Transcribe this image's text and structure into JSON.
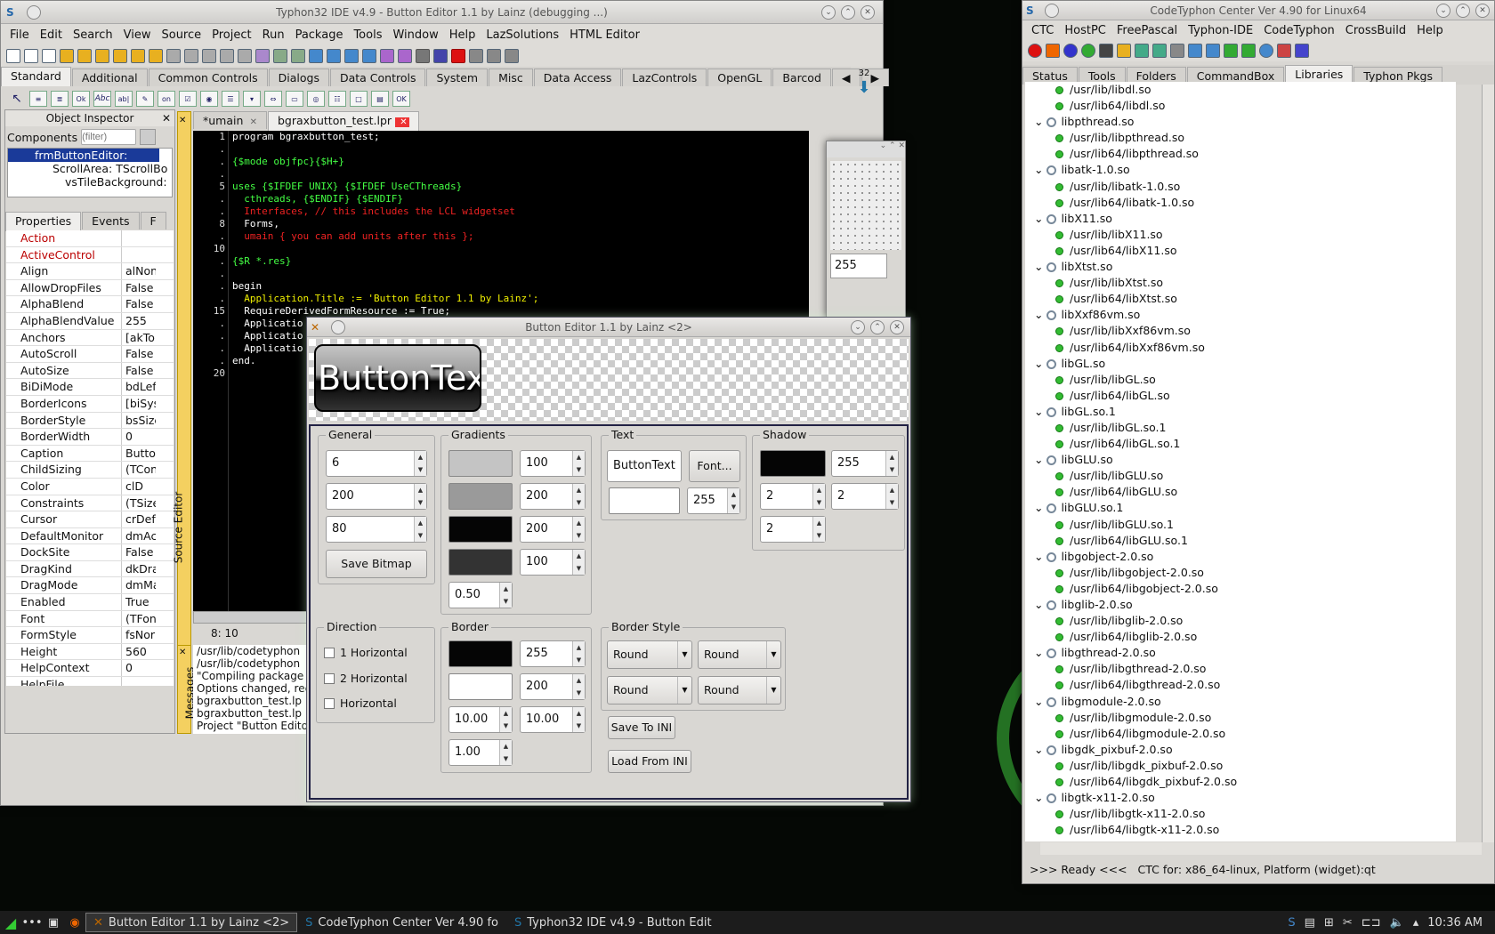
{
  "ide": {
    "title": "Typhon32 IDE v4.9 - Button Editor 1.1 by Lainz (debugging ...)",
    "menu": [
      "File",
      "Edit",
      "Search",
      "View",
      "Source",
      "Project",
      "Run",
      "Package",
      "Tools",
      "Window",
      "Help",
      "LazSolutions",
      "HTML Editor"
    ],
    "palette_tabs": [
      "Standard",
      "Additional",
      "Common Controls",
      "Dialogs",
      "Data Controls",
      "System",
      "Misc",
      "Data Access",
      "LazControls",
      "OpenGL",
      "Barcod"
    ],
    "palette_counter": "32",
    "object_inspector": {
      "title": "Object Inspector",
      "components_label": "Components",
      "filter_placeholder": "(filter)",
      "tree": [
        "frmButtonEditor: TfrmB",
        "ScrollArea: TScrollBo",
        "vsTileBackground:"
      ],
      "tabs": [
        "Properties",
        "Events",
        "F"
      ],
      "properties": [
        {
          "name": "Action",
          "value": "",
          "red": true
        },
        {
          "name": "ActiveControl",
          "value": "",
          "red": true
        },
        {
          "name": "Align",
          "value": "alNon"
        },
        {
          "name": "AllowDropFiles",
          "value": "False"
        },
        {
          "name": "AlphaBlend",
          "value": "False"
        },
        {
          "name": "AlphaBlendValue",
          "value": "255"
        },
        {
          "name": "Anchors",
          "value": "[akTo"
        },
        {
          "name": "AutoScroll",
          "value": "False"
        },
        {
          "name": "AutoSize",
          "value": "False"
        },
        {
          "name": "BiDiMode",
          "value": "bdLef"
        },
        {
          "name": "BorderIcons",
          "value": "[biSys"
        },
        {
          "name": "BorderStyle",
          "value": "bsSize"
        },
        {
          "name": "BorderWidth",
          "value": "0"
        },
        {
          "name": "Caption",
          "value": "Butto"
        },
        {
          "name": "ChildSizing",
          "value": "(TCon"
        },
        {
          "name": "Color",
          "value": "clD"
        },
        {
          "name": "Constraints",
          "value": "(TSize"
        },
        {
          "name": "Cursor",
          "value": "crDefa"
        },
        {
          "name": "DefaultMonitor",
          "value": "dmAc"
        },
        {
          "name": "DockSite",
          "value": "False"
        },
        {
          "name": "DragKind",
          "value": "dkDra"
        },
        {
          "name": "DragMode",
          "value": "dmMa"
        },
        {
          "name": "Enabled",
          "value": "True"
        },
        {
          "name": "Font",
          "value": "(TFon"
        },
        {
          "name": "FormStyle",
          "value": "fsNor"
        },
        {
          "name": "Height",
          "value": "560"
        },
        {
          "name": "HelpContext",
          "value": "0"
        },
        {
          "name": "HelpFile",
          "value": ""
        }
      ]
    },
    "editor_tabs": [
      "*umain",
      "bgraxbutton_test.lpr"
    ],
    "source_editor_label": "Source Editor",
    "messages_label": "Messages",
    "cursor_pos": "8: 10",
    "messages": [
      "/usr/lib/codetyphon",
      "/usr/lib/codetyphon",
      "\"Compiling package p",
      "Options changed, rec",
      "bgraxbutton_test.lp",
      "bgraxbutton_test.lp",
      "Project \"Button Edito"
    ],
    "code": [
      {
        "n": "1",
        "t": "program bgraxbutton_test;",
        "c": "kw"
      },
      {
        "n": ".",
        "t": "",
        "c": "kw"
      },
      {
        "n": ".",
        "t": "{$mode objfpc}{$H+}",
        "c": "dir"
      },
      {
        "n": ".",
        "t": "",
        "c": "kw"
      },
      {
        "n": "5",
        "t": "uses {$IFDEF UNIX} {$IFDEF UseCThreads}",
        "c": "dir"
      },
      {
        "n": ".",
        "t": "  cthreads, {$ENDIF} {$ENDIF}",
        "c": "dir"
      },
      {
        "n": ".",
        "t": "  Interfaces, // this includes the LCL widgetset",
        "c": "cm"
      },
      {
        "n": "8",
        "t": "  Forms,",
        "c": "kw"
      },
      {
        "n": ".",
        "t": "  umain { you can add units after this };",
        "c": "cm"
      },
      {
        "n": "10",
        "t": "",
        "c": "kw"
      },
      {
        "n": ".",
        "t": "{$R *.res}",
        "c": "dir"
      },
      {
        "n": ".",
        "t": "",
        "c": "kw"
      },
      {
        "n": ".",
        "t": "begin",
        "c": "kw"
      },
      {
        "n": ".",
        "t": "  Application.Title := 'Button Editor 1.1 by Lainz';",
        "c": "str"
      },
      {
        "n": "15",
        "t": "  RequireDerivedFormResource := True;",
        "c": "kw"
      },
      {
        "n": ".",
        "t": "  Applicatio",
        "c": "kw"
      },
      {
        "n": ".",
        "t": "  Applicatio",
        "c": "kw"
      },
      {
        "n": ".",
        "t": "  Applicatio",
        "c": "kw"
      },
      {
        "n": ".",
        "t": "end.",
        "c": "kw"
      },
      {
        "n": "20",
        "t": "",
        "c": "kw"
      }
    ]
  },
  "dialog": {
    "title": "Button Editor 1.1 by Lainz <2>",
    "preview_text": "ButtonText",
    "general": {
      "label": "General",
      "values": [
        "6",
        "200",
        "80"
      ],
      "save_bitmap": "Save Bitmap"
    },
    "gradients": {
      "label": "Gradients",
      "values": [
        "100",
        "200",
        "200",
        "100"
      ],
      "ratio": "0.50",
      "colors": [
        "#c4c4c4",
        "#9a9a9a",
        "#050505",
        "#333333"
      ]
    },
    "text": {
      "label": "Text",
      "caption": "ButtonText",
      "font_button": "Font...",
      "alpha": "255"
    },
    "shadow": {
      "label": "Shadow",
      "alpha": "255",
      "v1": "2",
      "v2": "2",
      "v3": "2"
    },
    "direction": {
      "label": "Direction",
      "options": [
        "1 Horizontal",
        "2 Horizontal",
        "Horizontal"
      ]
    },
    "border": {
      "label": "Border",
      "alpha1": "255",
      "alpha2": "200",
      "w1": "10.00",
      "w2": "10.00",
      "w3": "1.00"
    },
    "border_style": {
      "label": "Border Style",
      "values": [
        "Round",
        "Round",
        "Round",
        "Round"
      ],
      "save_ini": "Save To INI",
      "load_ini": "Load From INI"
    }
  },
  "ctc": {
    "title": "CodeTyphon Center Ver 4.90 for Linux64",
    "menu": [
      "CTC",
      "HostPC",
      "FreePascal",
      "Typhon-IDE",
      "CodeTyphon",
      "CrossBuild",
      "Help"
    ],
    "tabs": [
      "Status",
      "Tools",
      "Folders",
      "CommandBox",
      "Libraries",
      "Typhon Pkgs"
    ],
    "active_tab": "Libraries",
    "tree": [
      {
        "t": "/usr/lib/libdl.so",
        "lvl": 2
      },
      {
        "t": "/usr/lib64/libdl.so",
        "lvl": 2
      },
      {
        "t": "libpthread.so",
        "lvl": 1
      },
      {
        "t": "/usr/lib/libpthread.so",
        "lvl": 2
      },
      {
        "t": "/usr/lib64/libpthread.so",
        "lvl": 2
      },
      {
        "t": "libatk-1.0.so",
        "lvl": 1
      },
      {
        "t": "/usr/lib/libatk-1.0.so",
        "lvl": 2
      },
      {
        "t": "/usr/lib64/libatk-1.0.so",
        "lvl": 2
      },
      {
        "t": "libX11.so",
        "lvl": 1
      },
      {
        "t": "/usr/lib/libX11.so",
        "lvl": 2
      },
      {
        "t": "/usr/lib64/libX11.so",
        "lvl": 2
      },
      {
        "t": "libXtst.so",
        "lvl": 1
      },
      {
        "t": "/usr/lib/libXtst.so",
        "lvl": 2
      },
      {
        "t": "/usr/lib64/libXtst.so",
        "lvl": 2
      },
      {
        "t": "libXxf86vm.so",
        "lvl": 1
      },
      {
        "t": "/usr/lib/libXxf86vm.so",
        "lvl": 2
      },
      {
        "t": "/usr/lib64/libXxf86vm.so",
        "lvl": 2
      },
      {
        "t": "libGL.so",
        "lvl": 1
      },
      {
        "t": "/usr/lib/libGL.so",
        "lvl": 2
      },
      {
        "t": "/usr/lib64/libGL.so",
        "lvl": 2
      },
      {
        "t": "libGL.so.1",
        "lvl": 1
      },
      {
        "t": "/usr/lib/libGL.so.1",
        "lvl": 2
      },
      {
        "t": "/usr/lib64/libGL.so.1",
        "lvl": 2
      },
      {
        "t": "libGLU.so",
        "lvl": 1
      },
      {
        "t": "/usr/lib/libGLU.so",
        "lvl": 2
      },
      {
        "t": "/usr/lib64/libGLU.so",
        "lvl": 2
      },
      {
        "t": "libGLU.so.1",
        "lvl": 1
      },
      {
        "t": "/usr/lib/libGLU.so.1",
        "lvl": 2
      },
      {
        "t": "/usr/lib64/libGLU.so.1",
        "lvl": 2
      },
      {
        "t": "libgobject-2.0.so",
        "lvl": 1
      },
      {
        "t": "/usr/lib/libgobject-2.0.so",
        "lvl": 2
      },
      {
        "t": "/usr/lib64/libgobject-2.0.so",
        "lvl": 2
      },
      {
        "t": "libglib-2.0.so",
        "lvl": 1
      },
      {
        "t": "/usr/lib/libglib-2.0.so",
        "lvl": 2
      },
      {
        "t": "/usr/lib64/libglib-2.0.so",
        "lvl": 2
      },
      {
        "t": "libgthread-2.0.so",
        "lvl": 1
      },
      {
        "t": "/usr/lib/libgthread-2.0.so",
        "lvl": 2
      },
      {
        "t": "/usr/lib64/libgthread-2.0.so",
        "lvl": 2
      },
      {
        "t": "libgmodule-2.0.so",
        "lvl": 1
      },
      {
        "t": "/usr/lib/libgmodule-2.0.so",
        "lvl": 2
      },
      {
        "t": "/usr/lib64/libgmodule-2.0.so",
        "lvl": 2
      },
      {
        "t": "libgdk_pixbuf-2.0.so",
        "lvl": 1
      },
      {
        "t": "/usr/lib/libgdk_pixbuf-2.0.so",
        "lvl": 2
      },
      {
        "t": "/usr/lib64/libgdk_pixbuf-2.0.so",
        "lvl": 2
      },
      {
        "t": "libgtk-x11-2.0.so",
        "lvl": 1
      },
      {
        "t": "/usr/lib/libgtk-x11-2.0.so",
        "lvl": 2
      },
      {
        "t": "/usr/lib64/libgtk-x11-2.0.so",
        "lvl": 2
      }
    ],
    "status": ">>> Ready <<<   CTC for: x86_64-linux, Platform (widget):qt"
  },
  "taskbar": {
    "items": [
      "Button Editor 1.1 by Lainz <2>",
      "CodeTyphon Center Ver 4.90 fo",
      "Typhon32 IDE v4.9 - Button Edit"
    ],
    "clock": "10:36 AM"
  }
}
